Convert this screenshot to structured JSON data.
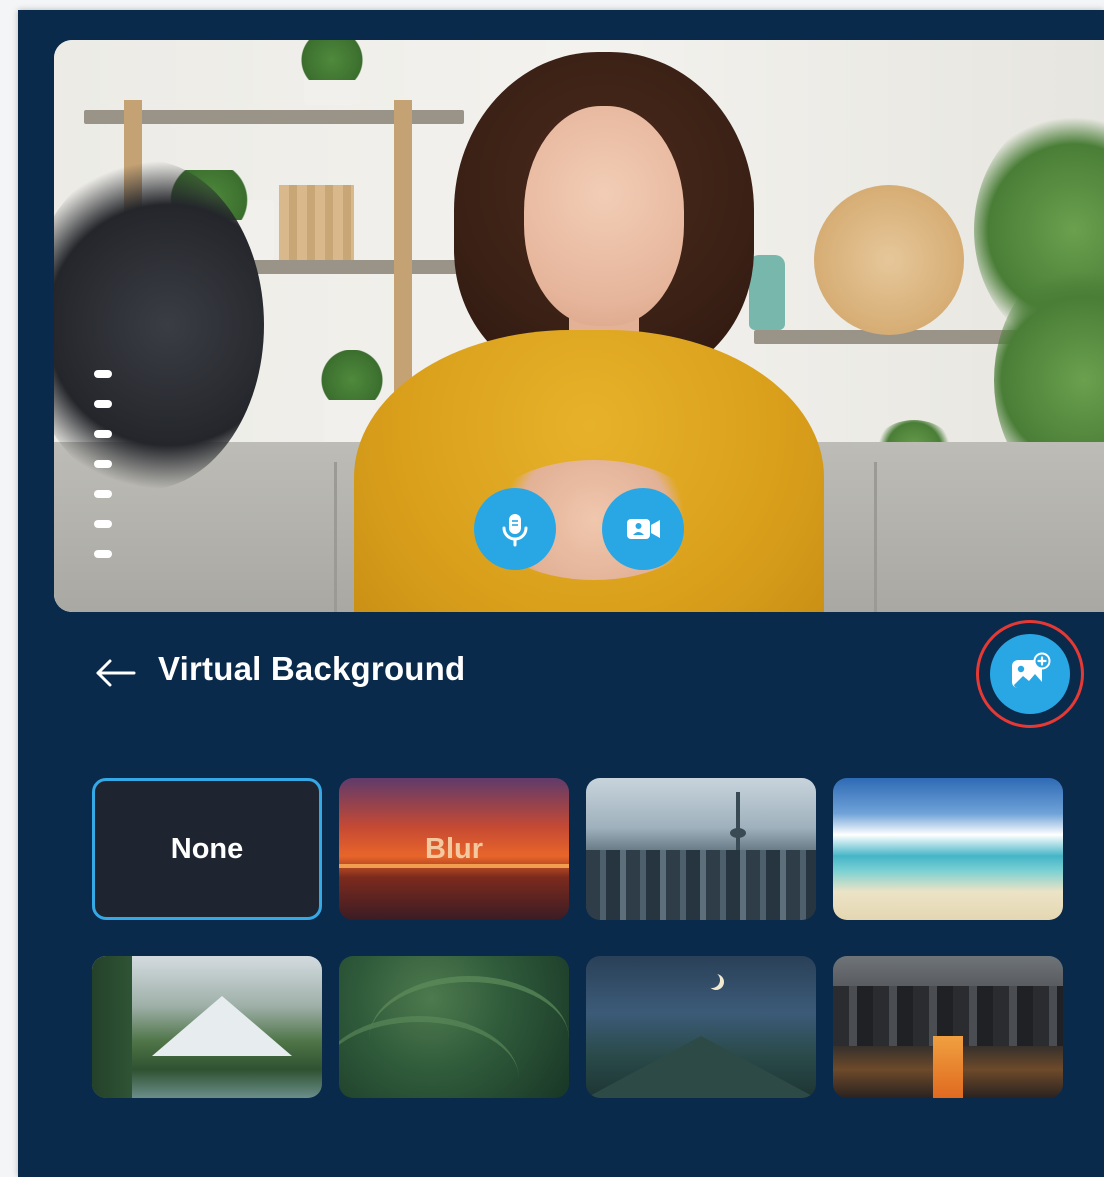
{
  "header": {
    "title": "Virtual Background"
  },
  "controls": {
    "mic_icon": "microphone-icon",
    "camera_icon": "video-camera-icon",
    "back_icon": "arrow-left-icon",
    "add_background_icon": "image-add-icon"
  },
  "colors": {
    "panel_background": "#0a2a4b",
    "accent": "#29a7e4",
    "selected_border": "#35a8e6",
    "highlight_ring": "#e53935"
  },
  "backgrounds": [
    {
      "label": "None",
      "selected": true
    },
    {
      "label": "Blur",
      "selected": false
    },
    {
      "label": "",
      "selected": false
    },
    {
      "label": "",
      "selected": false
    },
    {
      "label": "",
      "selected": false
    },
    {
      "label": "",
      "selected": false
    },
    {
      "label": "",
      "selected": false
    },
    {
      "label": "",
      "selected": false
    }
  ]
}
